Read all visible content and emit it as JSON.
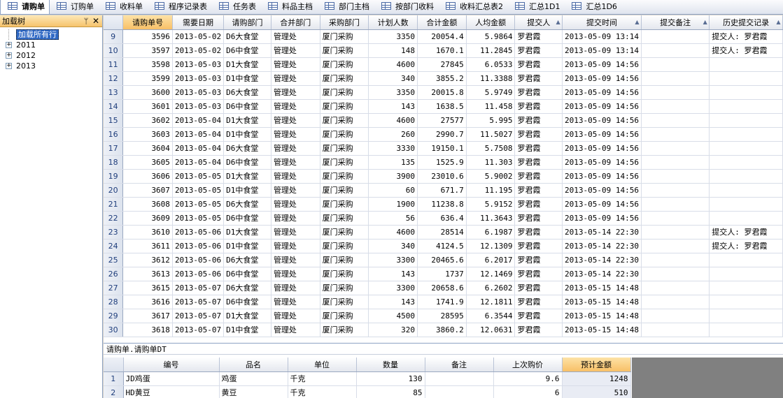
{
  "tabs": [
    {
      "label": "请购单",
      "active": true
    },
    {
      "label": "订购单",
      "active": false
    },
    {
      "label": "收料单",
      "active": false
    },
    {
      "label": "程序记录表",
      "active": false
    },
    {
      "label": "任务表",
      "active": false
    },
    {
      "label": "料品主档",
      "active": false
    },
    {
      "label": "部门主档",
      "active": false
    },
    {
      "label": "按部门收料",
      "active": false
    },
    {
      "label": "收料汇总表2",
      "active": false
    },
    {
      "label": "汇总1D1",
      "active": false
    },
    {
      "label": "汇总1D6",
      "active": false
    }
  ],
  "tree_panel": {
    "title": "加载树",
    "pin_glyph": "ᛘ",
    "close_glyph": "✕",
    "items": [
      {
        "label": "加载所有行",
        "selected": true,
        "expandable": false
      },
      {
        "label": "2011",
        "selected": false,
        "expandable": true
      },
      {
        "label": "2012",
        "selected": false,
        "expandable": true
      },
      {
        "label": "2013",
        "selected": false,
        "expandable": true
      }
    ]
  },
  "grid": {
    "columns": [
      "请购单号",
      "需要日期",
      "请购部门",
      "合并部门",
      "采购部门",
      "计划人数",
      "合计金额",
      "人均金额",
      "提交人",
      "提交时间",
      "提交备注",
      "历史提交记录"
    ],
    "sorted_column": 0,
    "filter_icon_columns": [
      8,
      9,
      10,
      11
    ],
    "rows": [
      {
        "n": "9",
        "c": [
          "3596",
          "2013-05-02",
          "D6大食堂",
          "管理处",
          "厦门采购",
          "3350",
          "20054.4",
          "5.9864",
          "罗君霞",
          "2013-05-09 13:14",
          "",
          "提交人: 罗君霞"
        ]
      },
      {
        "n": "10",
        "c": [
          "3597",
          "2013-05-02",
          "D6中食堂",
          "管理处",
          "厦门采购",
          "148",
          "1670.1",
          "11.2845",
          "罗君霞",
          "2013-05-09 13:14",
          "",
          "提交人: 罗君霞"
        ]
      },
      {
        "n": "11",
        "c": [
          "3598",
          "2013-05-03",
          "D1大食堂",
          "管理处",
          "厦门采购",
          "4600",
          "27845",
          "6.0533",
          "罗君霞",
          "2013-05-09 14:56",
          "",
          ""
        ]
      },
      {
        "n": "12",
        "c": [
          "3599",
          "2013-05-03",
          "D1中食堂",
          "管理处",
          "厦门采购",
          "340",
          "3855.2",
          "11.3388",
          "罗君霞",
          "2013-05-09 14:56",
          "",
          ""
        ]
      },
      {
        "n": "13",
        "c": [
          "3600",
          "2013-05-03",
          "D6大食堂",
          "管理处",
          "厦门采购",
          "3350",
          "20015.8",
          "5.9749",
          "罗君霞",
          "2013-05-09 14:56",
          "",
          ""
        ]
      },
      {
        "n": "14",
        "c": [
          "3601",
          "2013-05-03",
          "D6中食堂",
          "管理处",
          "厦门采购",
          "143",
          "1638.5",
          "11.458",
          "罗君霞",
          "2013-05-09 14:56",
          "",
          ""
        ]
      },
      {
        "n": "15",
        "c": [
          "3602",
          "2013-05-04",
          "D1大食堂",
          "管理处",
          "厦门采购",
          "4600",
          "27577",
          "5.995",
          "罗君霞",
          "2013-05-09 14:56",
          "",
          ""
        ]
      },
      {
        "n": "16",
        "c": [
          "3603",
          "2013-05-04",
          "D1中食堂",
          "管理处",
          "厦门采购",
          "260",
          "2990.7",
          "11.5027",
          "罗君霞",
          "2013-05-09 14:56",
          "",
          ""
        ]
      },
      {
        "n": "17",
        "c": [
          "3604",
          "2013-05-04",
          "D6大食堂",
          "管理处",
          "厦门采购",
          "3330",
          "19150.1",
          "5.7508",
          "罗君霞",
          "2013-05-09 14:56",
          "",
          ""
        ]
      },
      {
        "n": "18",
        "c": [
          "3605",
          "2013-05-04",
          "D6中食堂",
          "管理处",
          "厦门采购",
          "135",
          "1525.9",
          "11.303",
          "罗君霞",
          "2013-05-09 14:56",
          "",
          ""
        ]
      },
      {
        "n": "19",
        "c": [
          "3606",
          "2013-05-05",
          "D1大食堂",
          "管理处",
          "厦门采购",
          "3900",
          "23010.6",
          "5.9002",
          "罗君霞",
          "2013-05-09 14:56",
          "",
          ""
        ]
      },
      {
        "n": "20",
        "c": [
          "3607",
          "2013-05-05",
          "D1中食堂",
          "管理处",
          "厦门采购",
          "60",
          "671.7",
          "11.195",
          "罗君霞",
          "2013-05-09 14:56",
          "",
          ""
        ]
      },
      {
        "n": "21",
        "c": [
          "3608",
          "2013-05-05",
          "D6大食堂",
          "管理处",
          "厦门采购",
          "1900",
          "11238.8",
          "5.9152",
          "罗君霞",
          "2013-05-09 14:56",
          "",
          ""
        ]
      },
      {
        "n": "22",
        "c": [
          "3609",
          "2013-05-05",
          "D6中食堂",
          "管理处",
          "厦门采购",
          "56",
          "636.4",
          "11.3643",
          "罗君霞",
          "2013-05-09 14:56",
          "",
          ""
        ]
      },
      {
        "n": "23",
        "c": [
          "3610",
          "2013-05-06",
          "D1大食堂",
          "管理处",
          "厦门采购",
          "4600",
          "28514",
          "6.1987",
          "罗君霞",
          "2013-05-14 22:30",
          "",
          "提交人: 罗君霞"
        ]
      },
      {
        "n": "24",
        "c": [
          "3611",
          "2013-05-06",
          "D1中食堂",
          "管理处",
          "厦门采购",
          "340",
          "4124.5",
          "12.1309",
          "罗君霞",
          "2013-05-14 22:30",
          "",
          "提交人: 罗君霞"
        ]
      },
      {
        "n": "25",
        "c": [
          "3612",
          "2013-05-06",
          "D6大食堂",
          "管理处",
          "厦门采购",
          "3300",
          "20465.6",
          "6.2017",
          "罗君霞",
          "2013-05-14 22:30",
          "",
          ""
        ]
      },
      {
        "n": "26",
        "c": [
          "3613",
          "2013-05-06",
          "D6中食堂",
          "管理处",
          "厦门采购",
          "143",
          "1737",
          "12.1469",
          "罗君霞",
          "2013-05-14 22:30",
          "",
          ""
        ]
      },
      {
        "n": "27",
        "c": [
          "3615",
          "2013-05-07",
          "D6大食堂",
          "管理处",
          "厦门采购",
          "3300",
          "20658.6",
          "6.2602",
          "罗君霞",
          "2013-05-15 14:48",
          "",
          ""
        ]
      },
      {
        "n": "28",
        "c": [
          "3616",
          "2013-05-07",
          "D6中食堂",
          "管理处",
          "厦门采购",
          "143",
          "1741.9",
          "12.1811",
          "罗君霞",
          "2013-05-15 14:48",
          "",
          ""
        ]
      },
      {
        "n": "29",
        "c": [
          "3617",
          "2013-05-07",
          "D1大食堂",
          "管理处",
          "厦门采购",
          "4500",
          "28595",
          "6.3544",
          "罗君霞",
          "2013-05-15 14:48",
          "",
          ""
        ]
      },
      {
        "n": "30",
        "c": [
          "3618",
          "2013-05-07",
          "D1中食堂",
          "管理处",
          "厦门采购",
          "320",
          "3860.2",
          "12.0631",
          "罗君霞",
          "2013-05-15 14:48",
          "",
          ""
        ]
      }
    ]
  },
  "detail": {
    "caption": "请购单.请购单DT",
    "columns": [
      "编号",
      "品名",
      "单位",
      "数量",
      "备注",
      "上次购价",
      "预计金额"
    ],
    "sorted_column": 6,
    "rows": [
      {
        "n": "1",
        "c": [
          "JD鸡蛋",
          "鸡蛋",
          "千克",
          "130",
          "",
          "9.6",
          "1248"
        ]
      },
      {
        "n": "2",
        "c": [
          "HD黄豆",
          "黄豆",
          "千克",
          "85",
          "",
          "6",
          "510"
        ]
      }
    ]
  }
}
